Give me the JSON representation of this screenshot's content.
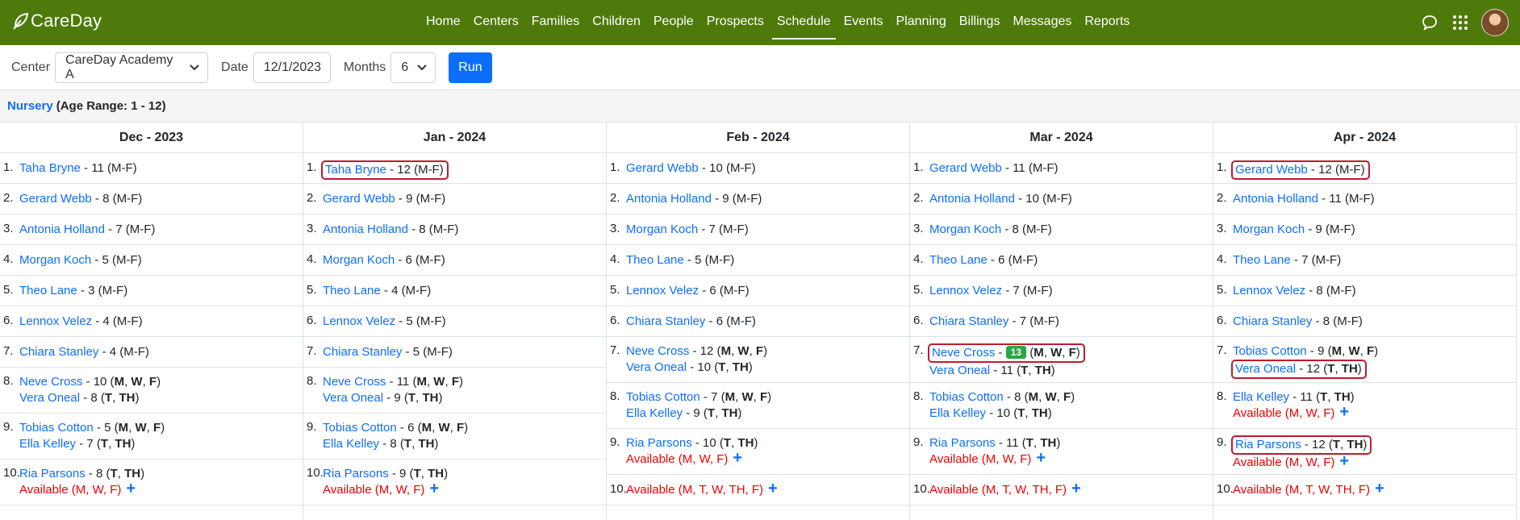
{
  "brand": "CareDay",
  "nav": [
    "Home",
    "Centers",
    "Families",
    "Children",
    "People",
    "Prospects",
    "Schedule",
    "Events",
    "Planning",
    "Billings",
    "Messages",
    "Reports"
  ],
  "nav_active": "Schedule",
  "filters": {
    "center_label": "Center",
    "center_value": "CareDay Academy A",
    "date_label": "Date",
    "date_value": "12/1/2023",
    "months_label": "Months",
    "months_value": "6",
    "run_label": "Run"
  },
  "section": {
    "room": "Nursery",
    "range": "(Age Range: 1 - 12)"
  },
  "colors": {
    "nav_bg": "#4d7a0a",
    "link": "#0d6efd",
    "available": "#ee0000",
    "highlight": "#c01b2e",
    "badge": "#28a745"
  },
  "columns": [
    {
      "month": "Dec - 2023",
      "rows": [
        {
          "n": "1.",
          "entries": [
            {
              "name": "Taha Bryne",
              "rest": " - 11 (M-F)"
            }
          ]
        },
        {
          "n": "2.",
          "entries": [
            {
              "name": "Gerard Webb",
              "rest": " - 8 (M-F)"
            }
          ]
        },
        {
          "n": "3.",
          "entries": [
            {
              "name": "Antonia Holland",
              "rest": " - 7 (M-F)"
            }
          ]
        },
        {
          "n": "4.",
          "entries": [
            {
              "name": "Morgan Koch",
              "rest": " - 5 (M-F)"
            }
          ]
        },
        {
          "n": "5.",
          "entries": [
            {
              "name": "Theo Lane",
              "rest": " - 3 (M-F)"
            }
          ]
        },
        {
          "n": "6.",
          "entries": [
            {
              "name": "Lennox Velez",
              "rest": " - 4 (M-F)"
            }
          ]
        },
        {
          "n": "7.",
          "entries": [
            {
              "name": "Chiara Stanley",
              "rest": " - 4 (M-F)"
            }
          ]
        },
        {
          "n": "8.",
          "entries": [
            {
              "name": "Neve Cross",
              "age": "10",
              "days": [
                "M",
                "W",
                "F"
              ]
            },
            {
              "name": "Vera Oneal",
              "age": "8",
              "days": [
                "T",
                "TH"
              ]
            }
          ]
        },
        {
          "n": "9.",
          "entries": [
            {
              "name": "Tobias Cotton",
              "age": "5",
              "days": [
                "M",
                "W",
                "F"
              ]
            },
            {
              "name": "Ella Kelley",
              "age": "7",
              "days": [
                "T",
                "TH"
              ]
            }
          ]
        },
        {
          "n": "10.",
          "entries": [
            {
              "name": "Ria Parsons",
              "age": "8",
              "days": [
                "T",
                "TH"
              ]
            },
            {
              "avail": "Available (M, W, F)"
            }
          ]
        }
      ]
    },
    {
      "month": "Jan - 2024",
      "rows": [
        {
          "n": "1.",
          "entries": [
            {
              "name": "Taha Bryne",
              "rest": " - 12 (M-F)",
              "hl": true
            }
          ]
        },
        {
          "n": "2.",
          "entries": [
            {
              "name": "Gerard Webb",
              "rest": " - 9 (M-F)"
            }
          ]
        },
        {
          "n": "3.",
          "entries": [
            {
              "name": "Antonia Holland",
              "rest": " - 8 (M-F)"
            }
          ]
        },
        {
          "n": "4.",
          "entries": [
            {
              "name": "Morgan Koch",
              "rest": " - 6 (M-F)"
            }
          ]
        },
        {
          "n": "5.",
          "entries": [
            {
              "name": "Theo Lane",
              "rest": " - 4 (M-F)"
            }
          ]
        },
        {
          "n": "6.",
          "entries": [
            {
              "name": "Lennox Velez",
              "rest": " - 5 (M-F)"
            }
          ]
        },
        {
          "n": "7.",
          "entries": [
            {
              "name": "Chiara Stanley",
              "rest": " - 5 (M-F)"
            }
          ]
        },
        {
          "n": "8.",
          "entries": [
            {
              "name": "Neve Cross",
              "age": "11",
              "days": [
                "M",
                "W",
                "F"
              ]
            },
            {
              "name": "Vera Oneal",
              "age": "9",
              "days": [
                "T",
                "TH"
              ]
            }
          ]
        },
        {
          "n": "9.",
          "entries": [
            {
              "name": "Tobias Cotton",
              "age": "6",
              "days": [
                "M",
                "W",
                "F"
              ]
            },
            {
              "name": "Ella Kelley",
              "age": "8",
              "days": [
                "T",
                "TH"
              ]
            }
          ]
        },
        {
          "n": "10.",
          "entries": [
            {
              "name": "Ria Parsons",
              "age": "9",
              "days": [
                "T",
                "TH"
              ]
            },
            {
              "avail": "Available (M, W, F)"
            }
          ]
        }
      ]
    },
    {
      "month": "Feb - 2024",
      "rows": [
        {
          "n": "1.",
          "entries": [
            {
              "name": "Gerard Webb",
              "rest": " - 10 (M-F)"
            }
          ]
        },
        {
          "n": "2.",
          "entries": [
            {
              "name": "Antonia Holland",
              "rest": " - 9 (M-F)"
            }
          ]
        },
        {
          "n": "3.",
          "entries": [
            {
              "name": "Morgan Koch",
              "rest": " - 7 (M-F)"
            }
          ]
        },
        {
          "n": "4.",
          "entries": [
            {
              "name": "Theo Lane",
              "rest": " - 5 (M-F)"
            }
          ]
        },
        {
          "n": "5.",
          "entries": [
            {
              "name": "Lennox Velez",
              "rest": " - 6 (M-F)"
            }
          ]
        },
        {
          "n": "6.",
          "entries": [
            {
              "name": "Chiara Stanley",
              "rest": " - 6 (M-F)"
            }
          ]
        },
        {
          "n": "7.",
          "entries": [
            {
              "name": "Neve Cross",
              "age": "12",
              "days": [
                "M",
                "W",
                "F"
              ]
            },
            {
              "name": "Vera Oneal",
              "age": "10",
              "days": [
                "T",
                "TH"
              ]
            }
          ]
        },
        {
          "n": "8.",
          "entries": [
            {
              "name": "Tobias Cotton",
              "age": "7",
              "days": [
                "M",
                "W",
                "F"
              ]
            },
            {
              "name": "Ella Kelley",
              "age": "9",
              "days": [
                "T",
                "TH"
              ]
            }
          ]
        },
        {
          "n": "9.",
          "entries": [
            {
              "name": "Ria Parsons",
              "age": "10",
              "days": [
                "T",
                "TH"
              ]
            },
            {
              "avail": "Available (M, W, F)"
            }
          ]
        },
        {
          "n": "10.",
          "entries": [
            {
              "avail": "Available (M, T, W, TH, F)"
            }
          ]
        }
      ]
    },
    {
      "month": "Mar - 2024",
      "rows": [
        {
          "n": "1.",
          "entries": [
            {
              "name": "Gerard Webb",
              "rest": " - 11 (M-F)"
            }
          ]
        },
        {
          "n": "2.",
          "entries": [
            {
              "name": "Antonia Holland",
              "rest": " - 10 (M-F)"
            }
          ]
        },
        {
          "n": "3.",
          "entries": [
            {
              "name": "Morgan Koch",
              "rest": " - 8 (M-F)"
            }
          ]
        },
        {
          "n": "4.",
          "entries": [
            {
              "name": "Theo Lane",
              "rest": " - 6 (M-F)"
            }
          ]
        },
        {
          "n": "5.",
          "entries": [
            {
              "name": "Lennox Velez",
              "rest": " - 7 (M-F)"
            }
          ]
        },
        {
          "n": "6.",
          "entries": [
            {
              "name": "Chiara Stanley",
              "rest": " - 7 (M-F)"
            }
          ]
        },
        {
          "n": "7.",
          "entries": [
            {
              "name": "Neve Cross",
              "badge": "13",
              "days": [
                "M",
                "W",
                "F"
              ],
              "hl": true
            },
            {
              "name": "Vera Oneal",
              "age": "11",
              "days": [
                "T",
                "TH"
              ]
            }
          ]
        },
        {
          "n": "8.",
          "entries": [
            {
              "name": "Tobias Cotton",
              "age": "8",
              "days": [
                "M",
                "W",
                "F"
              ]
            },
            {
              "name": "Ella Kelley",
              "age": "10",
              "days": [
                "T",
                "TH"
              ]
            }
          ]
        },
        {
          "n": "9.",
          "entries": [
            {
              "name": "Ria Parsons",
              "age": "11",
              "days": [
                "T",
                "TH"
              ]
            },
            {
              "avail": "Available (M, W, F)"
            }
          ]
        },
        {
          "n": "10.",
          "entries": [
            {
              "avail": "Available (M, T, W, TH, F)"
            }
          ]
        }
      ]
    },
    {
      "month": "Apr - 2024",
      "rows": [
        {
          "n": "1.",
          "entries": [
            {
              "name": "Gerard Webb",
              "rest": " - 12 (M-F)",
              "hl": true
            }
          ]
        },
        {
          "n": "2.",
          "entries": [
            {
              "name": "Antonia Holland",
              "rest": " - 11 (M-F)"
            }
          ]
        },
        {
          "n": "3.",
          "entries": [
            {
              "name": "Morgan Koch",
              "rest": " - 9 (M-F)"
            }
          ]
        },
        {
          "n": "4.",
          "entries": [
            {
              "name": "Theo Lane",
              "rest": " - 7 (M-F)"
            }
          ]
        },
        {
          "n": "5.",
          "entries": [
            {
              "name": "Lennox Velez",
              "rest": " - 8 (M-F)"
            }
          ]
        },
        {
          "n": "6.",
          "entries": [
            {
              "name": "Chiara Stanley",
              "rest": " - 8 (M-F)"
            }
          ]
        },
        {
          "n": "7.",
          "entries": [
            {
              "name": "Tobias Cotton",
              "age": "9",
              "days": [
                "M",
                "W",
                "F"
              ]
            },
            {
              "name": "Vera Oneal",
              "age": "12",
              "days": [
                "T",
                "TH"
              ],
              "hl": true
            }
          ]
        },
        {
          "n": "8.",
          "entries": [
            {
              "name": "Ella Kelley",
              "age": "11",
              "days": [
                "T",
                "TH"
              ]
            },
            {
              "avail": "Available (M, W, F)"
            }
          ]
        },
        {
          "n": "9.",
          "entries": [
            {
              "name": "Ria Parsons",
              "age": "12",
              "days": [
                "T",
                "TH"
              ],
              "hl": true
            },
            {
              "avail": "Available (M, W, F)"
            }
          ]
        },
        {
          "n": "10.",
          "entries": [
            {
              "avail": "Available (M, T, W, TH, F)"
            }
          ]
        }
      ]
    }
  ]
}
